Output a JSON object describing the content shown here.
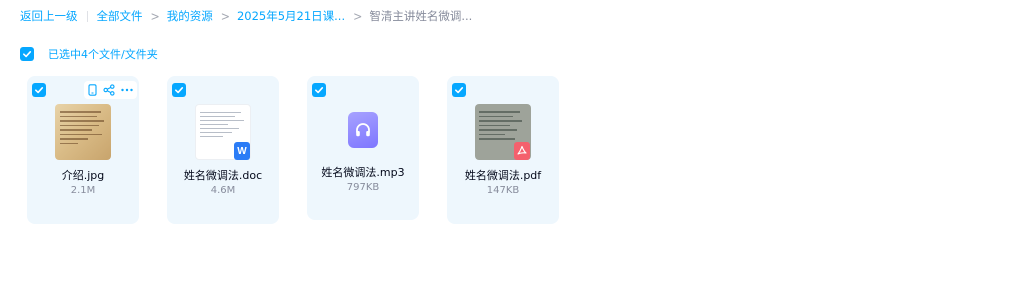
{
  "breadcrumb": {
    "back": "返回上一级",
    "items": [
      "全部文件",
      "我的资源",
      "2025年5月21日课...",
      "智清主讲姓名微调..."
    ]
  },
  "selection": {
    "label": "已选中4个文件/文件夹"
  },
  "files": [
    {
      "name": "介绍.jpg",
      "size": "2.1M",
      "type": "image",
      "icon": "image-thumbnail"
    },
    {
      "name": "姓名微调法.doc",
      "size": "4.6M",
      "type": "doc",
      "icon": "word-icon"
    },
    {
      "name": "姓名微调法.mp3",
      "size": "797KB",
      "type": "audio",
      "icon": "headphones-icon"
    },
    {
      "name": "姓名微调法.pdf",
      "size": "147KB",
      "type": "pdf",
      "icon": "pdf-icon"
    }
  ],
  "badges": {
    "word": "W"
  },
  "colors": {
    "accent": "#06a7ff",
    "card_bg": "#eef7fd",
    "audio": "#8f88ff",
    "word": "#2b7cf6",
    "pdf": "#f4606d"
  }
}
